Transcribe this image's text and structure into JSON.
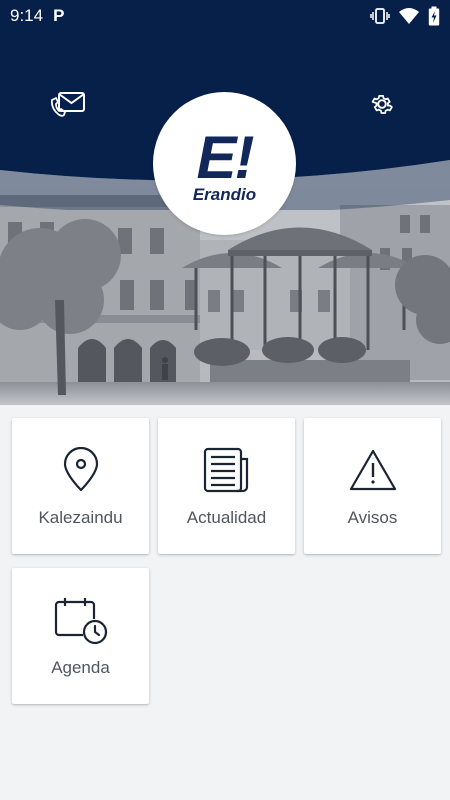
{
  "status_bar": {
    "time": "9:14",
    "app_indicator": "P",
    "icons": [
      "vibrate-icon",
      "wifi-icon",
      "battery-charging-icon"
    ]
  },
  "header": {
    "contact_icon": "mail-phone-icon",
    "settings_icon": "gear-icon",
    "logo": {
      "mark": "E!",
      "wordmark": "Erandio"
    },
    "colors": {
      "navy": "#06204a",
      "logo_blue": "#12275a"
    }
  },
  "tiles": [
    {
      "label": "Kalezaindu",
      "icon": "map-pin-icon"
    },
    {
      "label": "Actualidad",
      "icon": "newspaper-icon"
    },
    {
      "label": "Avisos",
      "icon": "warning-icon"
    },
    {
      "label": "Agenda",
      "icon": "calendar-clock-icon"
    }
  ]
}
